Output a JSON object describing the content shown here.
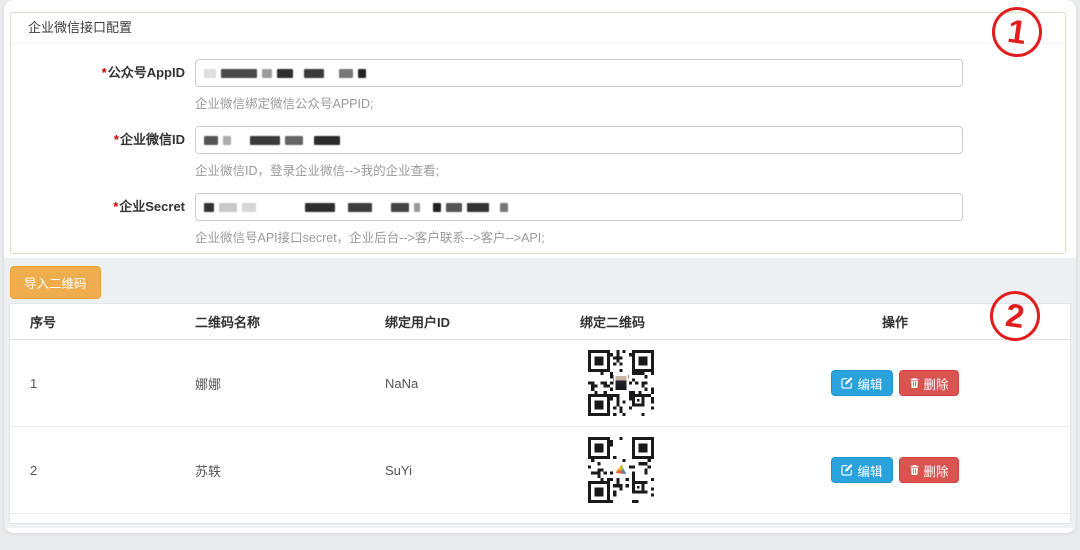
{
  "config_panel": {
    "title": "企业微信接口配置",
    "fields": [
      {
        "required_mark": "*",
        "label": "公众号AppID",
        "value": "",
        "value_masked": true,
        "help": "企业微信绑定微信公众号APPID;"
      },
      {
        "required_mark": "*",
        "label": "企业微信ID",
        "value": "",
        "value_masked": true,
        "help": "企业微信ID，登录企业微信-->我的企业查看;"
      },
      {
        "required_mark": "*",
        "label": "企业Secret",
        "value": "",
        "value_masked": true,
        "help": "企业微信号API接口secret，企业后台-->客户联系-->客户-->API;"
      }
    ]
  },
  "qr_section": {
    "import_button": "导入二维码",
    "table": {
      "headers": [
        "序号",
        "二维码名称",
        "绑定用户ID",
        "绑定二维码",
        "操作"
      ],
      "rows": [
        {
          "no": "1",
          "name": "娜娜",
          "user_id": "NaNa",
          "qr": "qr-code-nana"
        },
        {
          "no": "2",
          "name": "苏轶",
          "user_id": "SuYi",
          "qr": "qr-code-suyi"
        }
      ],
      "actions": {
        "edit": "编辑",
        "delete": "删除"
      }
    }
  },
  "annotations": {
    "circle_1": "1",
    "circle_2": "2"
  },
  "icons": {
    "edit": "pencil-square-icon",
    "delete": "trash-icon"
  },
  "colors": {
    "edit_button": "#2aa3dc",
    "delete_button": "#d9534f",
    "import_button": "#f0ad4e",
    "annotation_red": "#e21d1d",
    "panel_border": "#d8e3c5",
    "section_bg": "#edf0f3"
  }
}
